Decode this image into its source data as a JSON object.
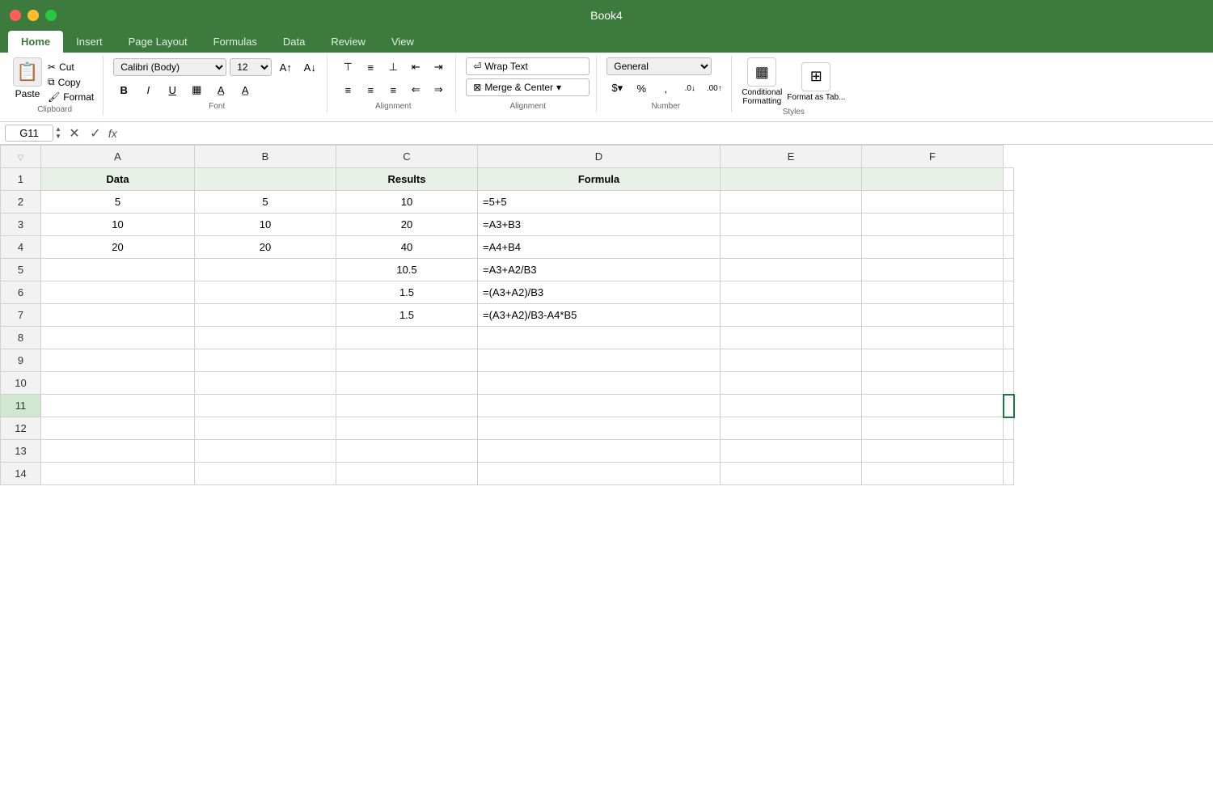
{
  "titleBar": {
    "title": "Book4",
    "closeLabel": "",
    "minLabel": "",
    "maxLabel": ""
  },
  "tabs": [
    {
      "label": "Home",
      "active": true
    },
    {
      "label": "Insert",
      "active": false
    },
    {
      "label": "Page Layout",
      "active": false
    },
    {
      "label": "Formulas",
      "active": false
    },
    {
      "label": "Data",
      "active": false
    },
    {
      "label": "Review",
      "active": false
    },
    {
      "label": "View",
      "active": false
    }
  ],
  "ribbon": {
    "paste_label": "Paste",
    "cut_label": "Cut",
    "copy_label": "Copy",
    "format_label": "Format",
    "font_name": "Calibri (Body)",
    "font_size": "12",
    "bold_label": "B",
    "italic_label": "I",
    "underline_label": "U",
    "wrap_text_label": "Wrap Text",
    "merge_center_label": "Merge & Center",
    "number_format": "General",
    "dollar_label": "$",
    "percent_label": "%",
    "comma_label": ",",
    "increase_decimal_label": ".0→.00",
    "decrease_decimal_label": ".00→.0",
    "conditional_format_label": "Conditional\nFormatting",
    "format_as_table_label": "Format\nas Tab..."
  },
  "formulaBar": {
    "cellRef": "G11",
    "formula": ""
  },
  "columns": [
    {
      "label": "",
      "id": "corner"
    },
    {
      "label": "A",
      "id": "A"
    },
    {
      "label": "B",
      "id": "B"
    },
    {
      "label": "C",
      "id": "C"
    },
    {
      "label": "D",
      "id": "D"
    },
    {
      "label": "E",
      "id": "E"
    },
    {
      "label": "F",
      "id": "F"
    }
  ],
  "rows": [
    {
      "rowNum": 1,
      "cells": [
        {
          "col": "A",
          "value": "Data",
          "type": "header"
        },
        {
          "col": "B",
          "value": "",
          "type": "header"
        },
        {
          "col": "C",
          "value": "Results",
          "type": "header"
        },
        {
          "col": "D",
          "value": "Formula",
          "type": "header"
        },
        {
          "col": "E",
          "value": "",
          "type": "header"
        },
        {
          "col": "F",
          "value": "",
          "type": "header"
        }
      ]
    },
    {
      "rowNum": 2,
      "cells": [
        {
          "col": "A",
          "value": "5",
          "type": "number"
        },
        {
          "col": "B",
          "value": "5",
          "type": "number"
        },
        {
          "col": "C",
          "value": "10",
          "type": "number"
        },
        {
          "col": "D",
          "value": "=5+5",
          "type": "text"
        },
        {
          "col": "E",
          "value": "",
          "type": "text"
        },
        {
          "col": "F",
          "value": "",
          "type": "text"
        }
      ]
    },
    {
      "rowNum": 3,
      "cells": [
        {
          "col": "A",
          "value": "10",
          "type": "number"
        },
        {
          "col": "B",
          "value": "10",
          "type": "number"
        },
        {
          "col": "C",
          "value": "20",
          "type": "number"
        },
        {
          "col": "D",
          "value": "=A3+B3",
          "type": "text"
        },
        {
          "col": "E",
          "value": "",
          "type": "text"
        },
        {
          "col": "F",
          "value": "",
          "type": "text"
        }
      ]
    },
    {
      "rowNum": 4,
      "cells": [
        {
          "col": "A",
          "value": "20",
          "type": "number"
        },
        {
          "col": "B",
          "value": "20",
          "type": "number"
        },
        {
          "col": "C",
          "value": "40",
          "type": "number"
        },
        {
          "col": "D",
          "value": "=A4+B4",
          "type": "text"
        },
        {
          "col": "E",
          "value": "",
          "type": "text"
        },
        {
          "col": "F",
          "value": "",
          "type": "text"
        }
      ]
    },
    {
      "rowNum": 5,
      "cells": [
        {
          "col": "A",
          "value": "",
          "type": "text"
        },
        {
          "col": "B",
          "value": "",
          "type": "text"
        },
        {
          "col": "C",
          "value": "10.5",
          "type": "number"
        },
        {
          "col": "D",
          "value": "=A3+A2/B3",
          "type": "text"
        },
        {
          "col": "E",
          "value": "",
          "type": "text"
        },
        {
          "col": "F",
          "value": "",
          "type": "text"
        }
      ]
    },
    {
      "rowNum": 6,
      "cells": [
        {
          "col": "A",
          "value": "",
          "type": "text"
        },
        {
          "col": "B",
          "value": "",
          "type": "text"
        },
        {
          "col": "C",
          "value": "1.5",
          "type": "number"
        },
        {
          "col": "D",
          "value": "=(A3+A2)/B3",
          "type": "text"
        },
        {
          "col": "E",
          "value": "",
          "type": "text"
        },
        {
          "col": "F",
          "value": "",
          "type": "text"
        }
      ]
    },
    {
      "rowNum": 7,
      "cells": [
        {
          "col": "A",
          "value": "",
          "type": "text"
        },
        {
          "col": "B",
          "value": "",
          "type": "text"
        },
        {
          "col": "C",
          "value": "1.5",
          "type": "number"
        },
        {
          "col": "D",
          "value": "=(A3+A2)/B3-A4*B5",
          "type": "text"
        },
        {
          "col": "E",
          "value": "",
          "type": "text"
        },
        {
          "col": "F",
          "value": "",
          "type": "text"
        }
      ]
    },
    {
      "rowNum": 8,
      "cells": [
        {
          "col": "A",
          "value": ""
        },
        {
          "col": "B",
          "value": ""
        },
        {
          "col": "C",
          "value": ""
        },
        {
          "col": "D",
          "value": ""
        },
        {
          "col": "E",
          "value": ""
        },
        {
          "col": "F",
          "value": ""
        }
      ]
    },
    {
      "rowNum": 9,
      "cells": [
        {
          "col": "A",
          "value": ""
        },
        {
          "col": "B",
          "value": ""
        },
        {
          "col": "C",
          "value": ""
        },
        {
          "col": "D",
          "value": ""
        },
        {
          "col": "E",
          "value": ""
        },
        {
          "col": "F",
          "value": ""
        }
      ]
    },
    {
      "rowNum": 10,
      "cells": [
        {
          "col": "A",
          "value": ""
        },
        {
          "col": "B",
          "value": ""
        },
        {
          "col": "C",
          "value": ""
        },
        {
          "col": "D",
          "value": ""
        },
        {
          "col": "E",
          "value": ""
        },
        {
          "col": "F",
          "value": ""
        }
      ]
    },
    {
      "rowNum": 11,
      "cells": [
        {
          "col": "A",
          "value": ""
        },
        {
          "col": "B",
          "value": ""
        },
        {
          "col": "C",
          "value": ""
        },
        {
          "col": "D",
          "value": ""
        },
        {
          "col": "E",
          "value": ""
        },
        {
          "col": "F",
          "value": ""
        }
      ]
    },
    {
      "rowNum": 12,
      "cells": [
        {
          "col": "A",
          "value": ""
        },
        {
          "col": "B",
          "value": ""
        },
        {
          "col": "C",
          "value": ""
        },
        {
          "col": "D",
          "value": ""
        },
        {
          "col": "E",
          "value": ""
        },
        {
          "col": "F",
          "value": ""
        }
      ]
    },
    {
      "rowNum": 13,
      "cells": [
        {
          "col": "A",
          "value": ""
        },
        {
          "col": "B",
          "value": ""
        },
        {
          "col": "C",
          "value": ""
        },
        {
          "col": "D",
          "value": ""
        },
        {
          "col": "E",
          "value": ""
        },
        {
          "col": "F",
          "value": ""
        }
      ]
    },
    {
      "rowNum": 14,
      "cells": [
        {
          "col": "A",
          "value": ""
        },
        {
          "col": "B",
          "value": ""
        },
        {
          "col": "C",
          "value": ""
        },
        {
          "col": "D",
          "value": ""
        },
        {
          "col": "E",
          "value": ""
        },
        {
          "col": "F",
          "value": ""
        }
      ]
    }
  ],
  "selectedCell": "G11"
}
